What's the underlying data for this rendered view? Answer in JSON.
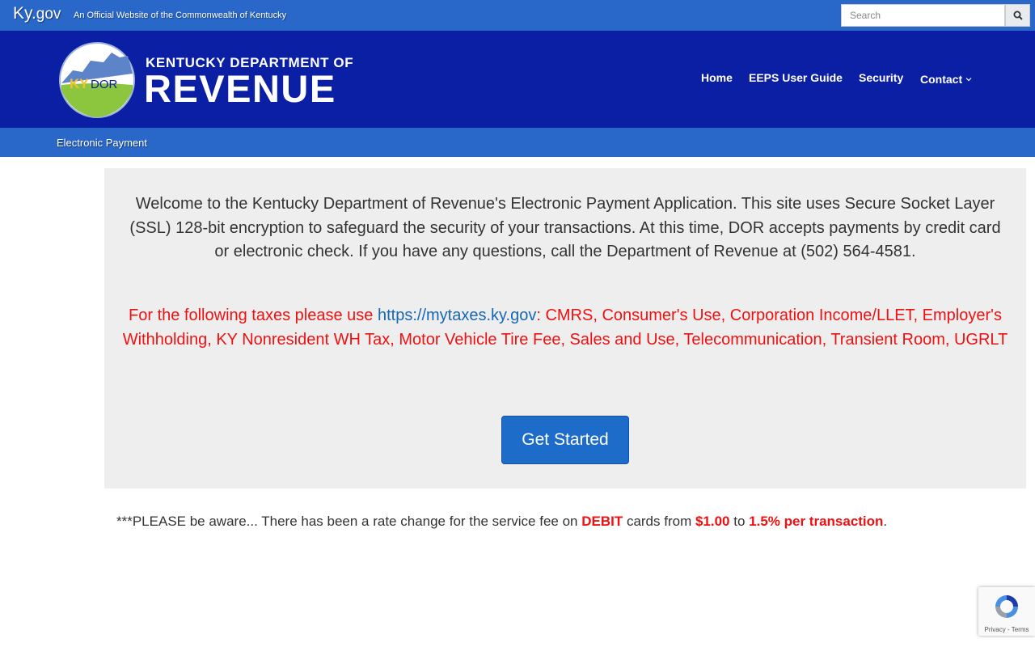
{
  "kygov": {
    "logo_main": "Ky.",
    "logo_suffix": "gov",
    "tagline": "An Official Website of the Commonwealth of Kentucky",
    "search_placeholder": "Search"
  },
  "header": {
    "seal_text_ky": "KY",
    "seal_text_dor": "DOR",
    "logo_line1": "KENTUCKY DEPARTMENT OF",
    "logo_line2": "REVENUE",
    "nav": {
      "home": "Home",
      "guide": "EEPS User Guide",
      "security": "Security",
      "contact": "Contact"
    }
  },
  "subnav": {
    "link": "Electronic Payment"
  },
  "main": {
    "welcome": "Welcome to the Kentucky Department of Revenue's Electronic Payment Application. This site uses Secure Socket Layer (SSL) 128-bit encryption to safeguard the security of your transactions. At this time, DOR accepts payments by credit card or electronic check. If you have any questions, call the Department of Revenue at (502) 564-4581.",
    "notice_prefix": "For the following taxes please use ",
    "notice_link": "https://mytaxes.ky.gov",
    "notice_suffix": ": CMRS, Consumer's Use, Corporation Income/LLET, Employer's Withholding, KY Nonresident WH Tax, Motor Vehicle Tire Fee, Sales and Use, Telecommunication, Transient Room, UGRLT",
    "get_started": "Get Started"
  },
  "rate_notice": {
    "part1": "***PLEASE be aware... There has been a rate change for the service fee on ",
    "debit": "DEBIT",
    "part2": " cards from ",
    "old_fee": "$1.00",
    "part3": " to ",
    "new_fee": "1.5% per transaction",
    "part4": "."
  },
  "recaptcha": {
    "links": "Privacy - Terms"
  },
  "colors": {
    "kybar": "#2968c9",
    "header": "#0a1fa3",
    "panel": "#eeeeee",
    "notice_red": "#ee1111",
    "link_blue": "#1667b5",
    "button": "#1e6cc9"
  }
}
